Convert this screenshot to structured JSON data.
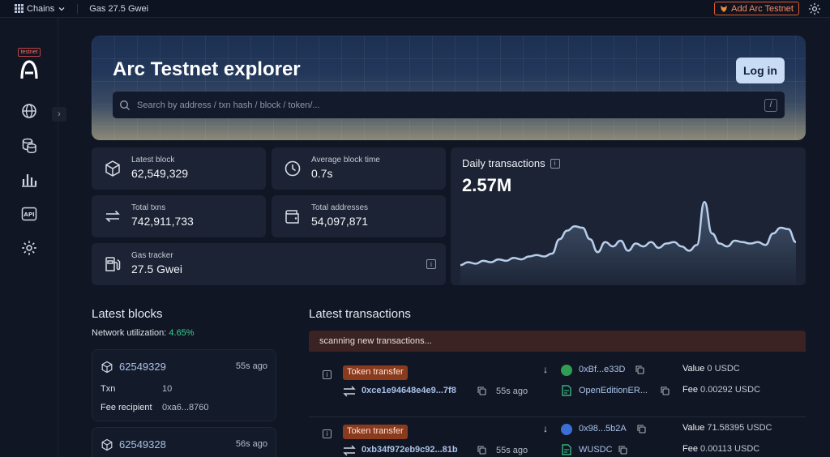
{
  "topbar": {
    "chains_label": "Chains",
    "gas_label": "Gas 27.5 Gwei",
    "add_network_label": "Add Arc Testnet"
  },
  "sidebar": {
    "badge": "testnet",
    "items": [
      "globe-icon",
      "coins-icon",
      "chart-icon",
      "api-icon",
      "settings-icon"
    ]
  },
  "hero": {
    "title": "Arc Testnet explorer",
    "login_label": "Log in",
    "search_placeholder": "Search by address / txn hash / block / token/...",
    "search_shortcut": "/"
  },
  "stats": {
    "latest_block": {
      "label": "Latest block",
      "value": "62,549,329"
    },
    "avg_block_time": {
      "label": "Average block time",
      "value": "0.7s"
    },
    "total_txns": {
      "label": "Total txns",
      "value": "742,911,733"
    },
    "total_addresses": {
      "label": "Total addresses",
      "value": "54,097,871"
    },
    "gas_tracker": {
      "label": "Gas tracker",
      "value": "27.5 Gwei"
    }
  },
  "chart_data": {
    "type": "area",
    "title": "Daily transactions",
    "value_label": "2.57M",
    "series": [
      {
        "values": [
          1.2,
          1.3,
          1.25,
          1.35,
          1.3,
          1.4,
          1.35,
          1.45,
          1.4,
          1.5,
          1.55,
          1.5,
          1.6,
          2.1,
          2.4,
          2.55,
          2.5,
          2.1,
          1.65,
          2.0,
          1.85,
          2.05,
          1.7,
          1.95,
          1.85,
          2.0,
          1.8,
          1.95,
          2.0,
          1.85,
          1.7,
          1.9,
          3.4,
          2.3,
          1.95,
          1.85,
          2.05,
          2.0,
          1.95,
          2.0,
          1.9,
          2.3,
          2.5,
          2.45,
          2.0
        ]
      }
    ],
    "grid": false
  },
  "latest_blocks": {
    "title": "Latest blocks",
    "utilization_label": "Network utilization:",
    "utilization_value": "4.65%",
    "items": [
      {
        "number": "62549329",
        "ago": "55s ago",
        "txn_label": "Txn",
        "txn_count": "10",
        "recipient_label": "Fee recipient",
        "recipient": "0xa6...8760"
      },
      {
        "number": "62549328",
        "ago": "56s ago"
      }
    ]
  },
  "latest_transactions": {
    "title": "Latest transactions",
    "scanning": "scanning new transactions...",
    "items": [
      {
        "type": "Token transfer",
        "hash": "0xce1e94648e4e9...7f8",
        "ago": "55s ago",
        "to": "0xBf...e33D",
        "token": "OpenEditionER...",
        "value_label": "Value",
        "value": "0 USDC",
        "fee_label": "Fee",
        "fee": "0.00292 USDC",
        "avatar_color": "#2f9e52"
      },
      {
        "type": "Token transfer",
        "hash": "0xb34f972eb9c92...81b",
        "ago": "55s ago",
        "to": "0x98...5b2A",
        "token": "WUSDC",
        "value_label": "Value",
        "value": "71.58395 USDC",
        "fee_label": "Fee",
        "fee": "0.00113 USDC",
        "avatar_color": "#3b6fd6"
      }
    ]
  }
}
